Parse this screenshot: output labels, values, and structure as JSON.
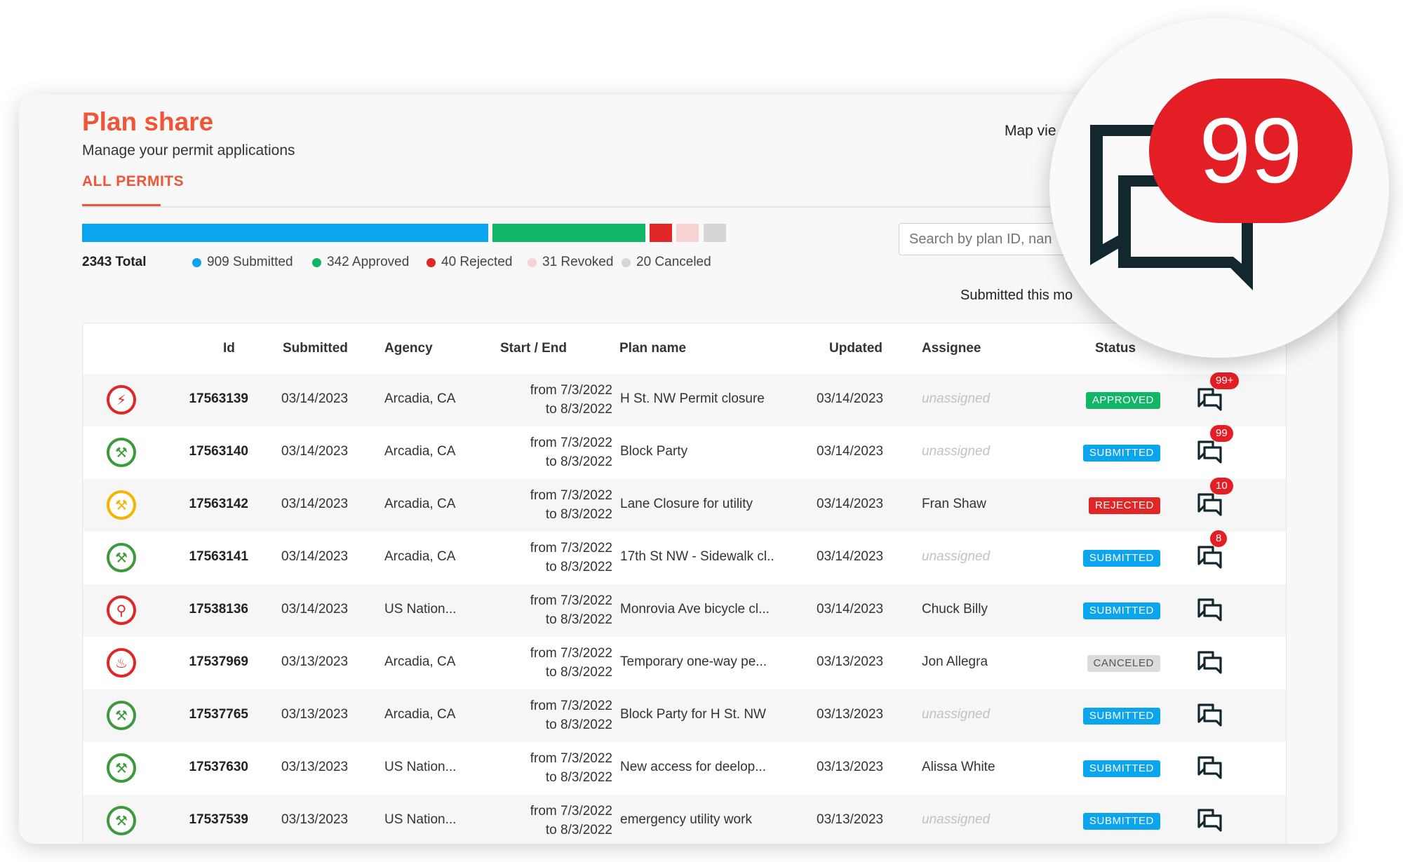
{
  "header": {
    "title": "Plan share",
    "subtitle": "Manage your permit applications",
    "tab_all_permits": "ALL PERMITS",
    "map_view": "Map vie"
  },
  "summary": {
    "total": "2343 Total",
    "submitted": "909 Submitted",
    "approved": "342 Approved",
    "rejected": "40 Rejected",
    "revoked": "31 Revoked",
    "canceled": "20 Canceled"
  },
  "summary_counts": {
    "submitted": 909,
    "approved": 342,
    "rejected": 40,
    "revoked": 31,
    "canceled": 20
  },
  "colors": {
    "accent": "#f05537",
    "submitted": "#0aa5ee",
    "approved": "#11b566",
    "rejected": "#e02626",
    "revoked": "#f8d2d2",
    "canceled": "#d6d6d6",
    "notification": "#e31e24"
  },
  "search": {
    "placeholder": "Search by plan ID, nan"
  },
  "filter": {
    "submitted_this_month": "Submitted this mo"
  },
  "table": {
    "columns": {
      "id": "Id",
      "submitted": "Submitted",
      "agency": "Agency",
      "start_end": "Start / End",
      "plan_name": "Plan name",
      "updated": "Updated",
      "assignee": "Assignee",
      "status": "Status"
    },
    "rows": [
      {
        "icon": "lightning-icon",
        "ring": "#e02626",
        "glyph": "⚡",
        "id": "17563139",
        "submitted": "03/14/2023",
        "agency": "Arcadia, CA",
        "from": "from 7/3/2022",
        "to": "to 8/3/2022",
        "plan": "H St. NW Permit closure",
        "updated": "03/14/2023",
        "assignee": "unassigned",
        "unassigned": true,
        "status": "APPROVED",
        "status_color": "#11b566",
        "messages": "99+"
      },
      {
        "icon": "construction-worker-icon",
        "ring": "#3c9a3c",
        "glyph": "⚒",
        "id": "17563140",
        "submitted": "03/14/2023",
        "agency": "Arcadia, CA",
        "from": "from 7/3/2022",
        "to": "to 8/3/2022",
        "plan": "Block Party",
        "updated": "03/14/2023",
        "assignee": "unassigned",
        "unassigned": true,
        "status": "SUBMITTED",
        "status_color": "#0aa5ee",
        "messages": "99"
      },
      {
        "icon": "construction-worker-icon",
        "ring": "#f5b400",
        "glyph": "⚒",
        "id": "17563142",
        "submitted": "03/14/2023",
        "agency": "Arcadia, CA",
        "from": "from 7/3/2022",
        "to": "to 8/3/2022",
        "plan": "Lane Closure for utility",
        "updated": "03/14/2023",
        "assignee": "Fran Shaw",
        "unassigned": false,
        "status": "REJECTED",
        "status_color": "#e02626",
        "messages": "10"
      },
      {
        "icon": "construction-worker-icon",
        "ring": "#3c9a3c",
        "glyph": "⚒",
        "id": "17563141",
        "submitted": "03/14/2023",
        "agency": "Arcadia, CA",
        "from": "from 7/3/2022",
        "to": "to 8/3/2022",
        "plan": "17th St NW - Sidewalk cl..",
        "updated": "03/14/2023",
        "assignee": "unassigned",
        "unassigned": true,
        "status": "SUBMITTED",
        "status_color": "#0aa5ee",
        "messages": "8"
      },
      {
        "icon": "water-tap-icon",
        "ring": "#e02626",
        "glyph": "⚲",
        "id": "17538136",
        "submitted": "03/14/2023",
        "agency": "US Nation...",
        "from": "from 7/3/2022",
        "to": "to 8/3/2022",
        "plan": "Monrovia Ave bicycle cl...",
        "updated": "03/14/2023",
        "assignee": "Chuck Billy",
        "unassigned": false,
        "status": "SUBMITTED",
        "status_color": "#0aa5ee",
        "messages": ""
      },
      {
        "icon": "fire-icon",
        "ring": "#e02626",
        "glyph": "♨",
        "id": "17537969",
        "submitted": "03/13/2023",
        "agency": "Arcadia, CA",
        "from": "from 7/3/2022",
        "to": "to 8/3/2022",
        "plan": "Temporary one-way pe...",
        "updated": "03/13/2023",
        "assignee": "Jon Allegra",
        "unassigned": false,
        "status": "CANCELED",
        "status_color": "#dcdcdc",
        "messages": ""
      },
      {
        "icon": "construction-worker-icon",
        "ring": "#3c9a3c",
        "glyph": "⚒",
        "id": "17537765",
        "submitted": "03/13/2023",
        "agency": "Arcadia, CA",
        "from": "from 7/3/2022",
        "to": "to 8/3/2022",
        "plan": "Block Party for H St. NW",
        "updated": "03/13/2023",
        "assignee": "unassigned",
        "unassigned": true,
        "status": "SUBMITTED",
        "status_color": "#0aa5ee",
        "messages": ""
      },
      {
        "icon": "construction-worker-icon",
        "ring": "#3c9a3c",
        "glyph": "⚒",
        "id": "17537630",
        "submitted": "03/13/2023",
        "agency": "US Nation...",
        "from": "from 7/3/2022",
        "to": "to 8/3/2022",
        "plan": "New access for deelop...",
        "updated": "03/13/2023",
        "assignee": "Alissa White",
        "unassigned": false,
        "status": "SUBMITTED",
        "status_color": "#0aa5ee",
        "messages": ""
      },
      {
        "icon": "construction-worker-icon",
        "ring": "#3c9a3c",
        "glyph": "⚒",
        "id": "17537539",
        "submitted": "03/13/2023",
        "agency": "US Nation...",
        "from": "from 7/3/2022",
        "to": "to 8/3/2022",
        "plan": "emergency utility work",
        "updated": "03/13/2023",
        "assignee": "unassigned",
        "unassigned": true,
        "status": "SUBMITTED",
        "status_color": "#0aa5ee",
        "messages": ""
      }
    ]
  },
  "magnifier": {
    "count": "99"
  }
}
